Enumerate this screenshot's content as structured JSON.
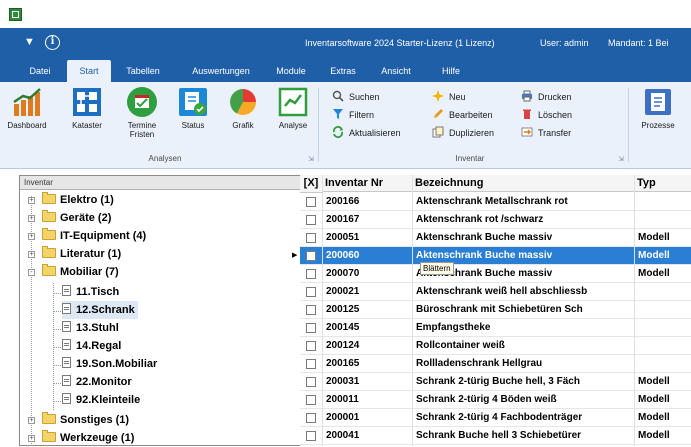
{
  "titlebar": {
    "app_title": "Inventarsoftware 2024 Starter-Lizenz (1 Lizenz)",
    "user": "User: admin",
    "mandant": "Mandant: 1 Bei"
  },
  "tabs": [
    {
      "label": "Datei"
    },
    {
      "label": "Start",
      "active": true
    },
    {
      "label": "Tabellen"
    },
    {
      "label": "Auswertungen"
    },
    {
      "label": "Module"
    },
    {
      "label": "Extras"
    },
    {
      "label": "Ansicht"
    },
    {
      "label": "Hilfe"
    }
  ],
  "ribbon": {
    "analysen": {
      "buttons": [
        "Dashboard",
        "Kataster",
        "Termine Fristen",
        "Status",
        "Grafik",
        "Analyse"
      ],
      "group_label": "Analysen"
    },
    "inventar": {
      "col1": [
        "Suchen",
        "Filtern",
        "Aktualisieren"
      ],
      "col2": [
        "Neu",
        "Bearbeiten",
        "Duplizieren"
      ],
      "col3": [
        "Drucken",
        "Löschen",
        "Transfer"
      ],
      "group_label": "Inventar"
    },
    "prozesse": {
      "label": "Prozesse"
    }
  },
  "tree": {
    "header": "Inventar",
    "nodes": [
      {
        "label": "Elektro  (1)",
        "expander": "+"
      },
      {
        "label": "Geräte  (2)",
        "expander": "+"
      },
      {
        "label": "IT-Equipment  (4)",
        "expander": "+"
      },
      {
        "label": "Literatur  (1)",
        "expander": "+"
      },
      {
        "label": "Mobiliar  (7)",
        "expander": "-"
      },
      {
        "label": "11.Tisch"
      },
      {
        "label": "12.Schrank"
      },
      {
        "label": "13.Stuhl"
      },
      {
        "label": "14.Regal"
      },
      {
        "label": "19.Son.Mobiliar"
      },
      {
        "label": "22.Monitor"
      },
      {
        "label": "92.Kleinteile"
      },
      {
        "label": "Sonstiges  (1)",
        "expander": "+"
      },
      {
        "label": "Werkzeuge  (1)",
        "expander": "+"
      }
    ]
  },
  "grid": {
    "columns": [
      "[X]",
      "Inventar Nr",
      "Bezeichnung",
      "Typ"
    ],
    "rows": [
      {
        "nr": "200166",
        "bez": "Aktenschrank  Metallschrank rot",
        "typ": ""
      },
      {
        "nr": "200167",
        "bez": "Aktenschrank  rot /schwarz",
        "typ": ""
      },
      {
        "nr": "200051",
        "bez": "Aktenschrank Buche massiv",
        "typ": "Modell"
      },
      {
        "nr": "200060",
        "bez": "Aktenschrank Buche massiv",
        "typ": "Modell",
        "selected": true
      },
      {
        "nr": "200070",
        "bez": "Aktenschrank Buche massiv",
        "typ": "Modell"
      },
      {
        "nr": "200021",
        "bez": "Aktenschrank weiß hell abschliessb",
        "typ": ""
      },
      {
        "nr": "200125",
        "bez": "Büroschrank mit Schiebetüren Sch",
        "typ": ""
      },
      {
        "nr": "200145",
        "bez": "Empfangstheke",
        "typ": ""
      },
      {
        "nr": "200124",
        "bez": "Rollcontainer weiß",
        "typ": ""
      },
      {
        "nr": "200165",
        "bez": "Rollladenschrank Hellgrau",
        "typ": ""
      },
      {
        "nr": "200031",
        "bez": "Schrank  2-türig Buche hell, 3 Fäch",
        "typ": "Modell"
      },
      {
        "nr": "200011",
        "bez": "Schrank 2-türig 4 Böden weiß",
        "typ": "Modell"
      },
      {
        "nr": "200001",
        "bez": "Schrank 2-türig 4 Fachbodenträger",
        "typ": "Modell"
      },
      {
        "nr": "200041",
        "bez": "Schrank Buche hell 3 Schiebetürer",
        "typ": "Modell"
      }
    ],
    "tooltip": "Blättern"
  },
  "colors": {
    "title_bar": "#1f5fa8",
    "ribbon_bg": "#eaf1fa",
    "selected_row": "#2a7fd4"
  }
}
